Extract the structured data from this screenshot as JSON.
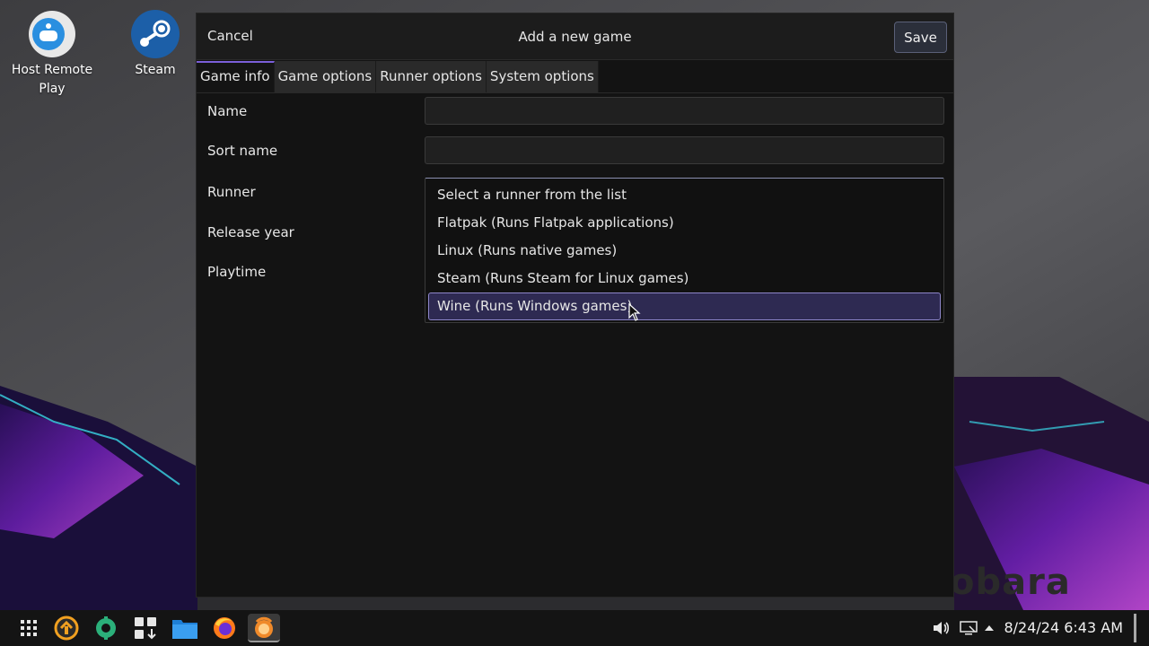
{
  "desktop": {
    "icons": [
      {
        "label": "Host Remote Play",
        "icon": "remote-play-icon"
      },
      {
        "label": "Steam",
        "icon": "steam-icon"
      }
    ],
    "watermark": "obara"
  },
  "dialog": {
    "title": "Add a new game",
    "cancel_label": "Cancel",
    "save_label": "Save",
    "tabs": [
      {
        "label": "Game info",
        "active": true
      },
      {
        "label": "Game options",
        "active": false
      },
      {
        "label": "Runner options",
        "active": false
      },
      {
        "label": "System options",
        "active": false
      }
    ],
    "form": {
      "name_label": "Name",
      "name_value": "",
      "sort_name_label": "Sort name",
      "sort_name_value": "",
      "runner_label": "Runner",
      "release_year_label": "Release year",
      "playtime_label": "Playtime"
    },
    "runner_options": [
      {
        "label": "Select a runner from the list",
        "selected": false
      },
      {
        "label": "Flatpak (Runs Flatpak applications)",
        "selected": false
      },
      {
        "label": "Linux (Runs native games)",
        "selected": false
      },
      {
        "label": "Steam (Runs Steam for Linux games)",
        "selected": false
      },
      {
        "label": "Wine (Runs Windows games)",
        "selected": true
      }
    ]
  },
  "taskbar": {
    "apps": [
      "app-launcher-icon",
      "update-icon",
      "tools-icon",
      "app-grid-download-icon",
      "files-icon",
      "firefox-icon",
      "lutris-icon"
    ],
    "active_app": "lutris-icon",
    "clock": "8/24/24 6:43 AM",
    "tray": [
      "volume-icon",
      "display-icon",
      "tray-expand-icon"
    ]
  },
  "colors": {
    "accent": "#7b5fd9",
    "selection_bg": "#2e2a52",
    "dialog_bg": "#131313"
  }
}
